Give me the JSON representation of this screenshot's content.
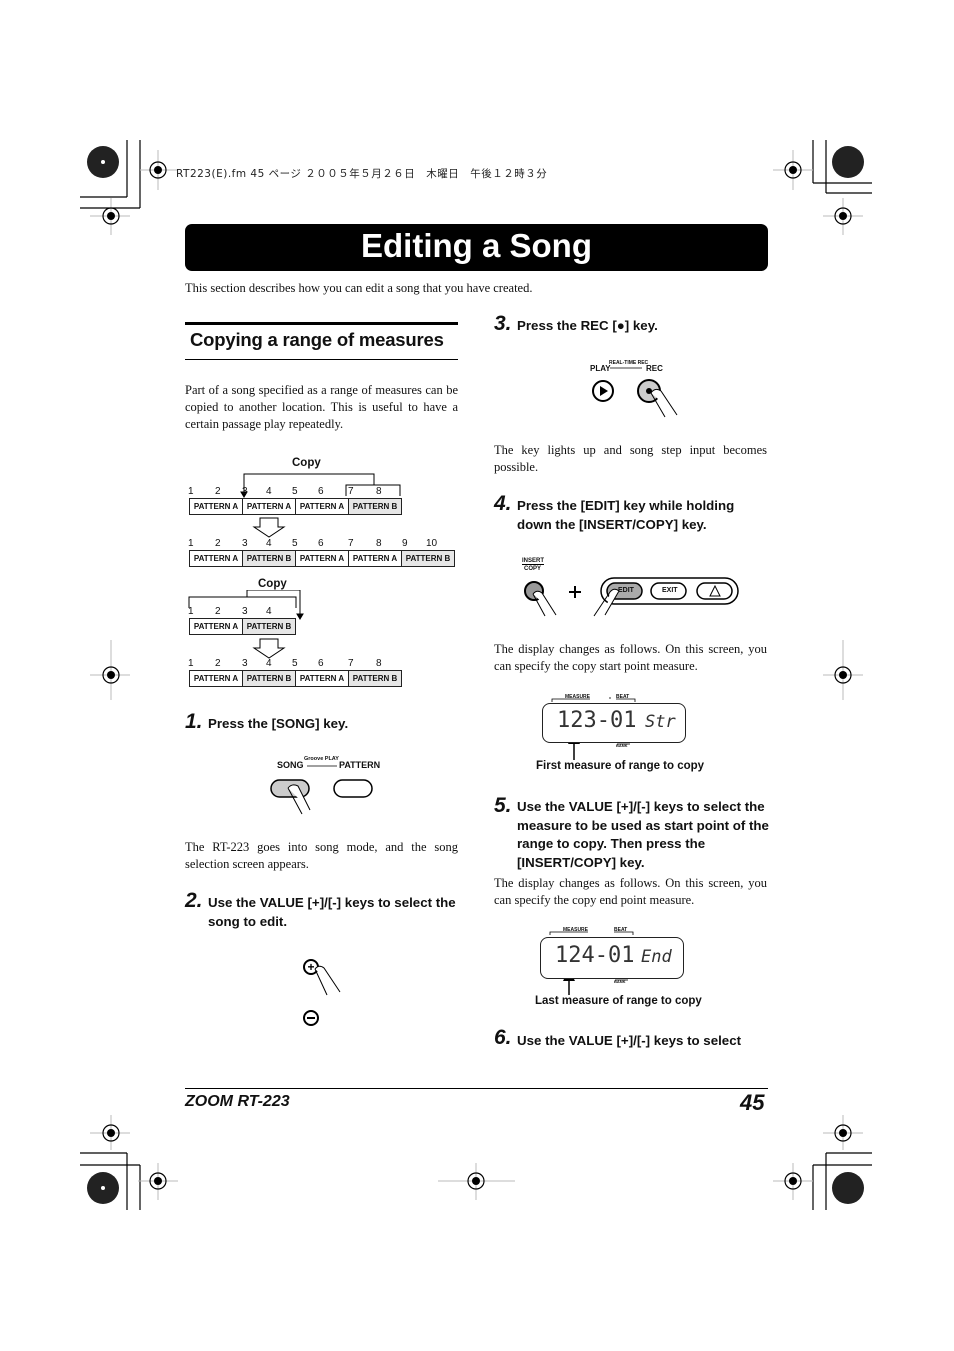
{
  "header_meta": "RT223(E).fm  45 ページ  ２００５年５月２６日　木曜日　午後１２時３分",
  "title": "Editing a Song",
  "intro": "This section describes how you can edit a song that you have created.",
  "section": {
    "heading": "Copying a range of measures",
    "paragraph": "Part of a song specified as a range of measures can be copied to another location. This is useful to have a certain passage play repeatedly."
  },
  "diagram1": {
    "copy_label": "Copy",
    "before_numbers": [
      "1",
      "2",
      "3",
      "4",
      "5",
      "6",
      "7",
      "8"
    ],
    "before_patterns": [
      "PATTERN A",
      "PATTERN A",
      "PATTERN A",
      "PATTERN B"
    ],
    "after_numbers": [
      "1",
      "2",
      "3",
      "4",
      "5",
      "6",
      "7",
      "8",
      "9",
      "10"
    ],
    "after_patterns": [
      "PATTERN A",
      "PATTERN B",
      "PATTERN A",
      "PATTERN A",
      "PATTERN B"
    ]
  },
  "diagram2": {
    "copy_label": "Copy",
    "before_numbers": [
      "1",
      "2",
      "3",
      "4"
    ],
    "before_patterns": [
      "PATTERN A",
      "PATTERN B"
    ],
    "after_numbers": [
      "1",
      "2",
      "3",
      "4",
      "5",
      "6",
      "7",
      "8"
    ],
    "after_patterns": [
      "PATTERN A",
      "PATTERN B",
      "PATTERN A",
      "PATTERN B"
    ]
  },
  "steps": [
    {
      "num": "1.",
      "text": "Press the [SONG] key.",
      "after": "The RT-223 goes into song mode, and the song selection screen appears.",
      "keys": {
        "left": "SONG",
        "middle": "Groove PLAY",
        "right": "PATTERN"
      }
    },
    {
      "num": "2.",
      "text": "Use the VALUE [+]/[-] keys to select the song to edit."
    },
    {
      "num": "3.",
      "text": "Press the REC [●] key.",
      "after": "The key lights up and song step input becomes possible.",
      "keys": {
        "left": "PLAY",
        "middle": "REAL-TIME REC",
        "right": "REC"
      }
    },
    {
      "num": "4.",
      "text": "Press the [EDIT] key while holding down the [INSERT/COPY] key.",
      "after": "The display changes as follows. On this screen, you can specify the copy start point measure.",
      "keys": {
        "insert_copy_top": "INSERT",
        "insert_copy_bottom": "COPY",
        "edit": "EDIT",
        "exit": "EXIT"
      }
    },
    {
      "num": "5.",
      "text": "Use the VALUE [+]/[-] keys to select the measure to be used as start point of the range to copy. Then press the [INSERT/COPY] key.",
      "after": "The display changes as follows. On this screen, you can specify the copy end point measure."
    },
    {
      "num": "6.",
      "text": "Use the VALUE [+]/[-] keys to select"
    }
  ],
  "display1": {
    "measure_label": "MEASURE",
    "beat_label": "BEAT",
    "bank_label": "BANK",
    "reading": "123-01",
    "mode": "Str",
    "caption": "First measure of range to copy"
  },
  "display2": {
    "measure_label": "MEASURE",
    "beat_label": "BEAT",
    "bank_label": "BANK",
    "reading": "124-01",
    "mode": "End",
    "caption": "Last measure of range to copy"
  },
  "footer": {
    "product": "ZOOM RT-223",
    "page": "45"
  }
}
